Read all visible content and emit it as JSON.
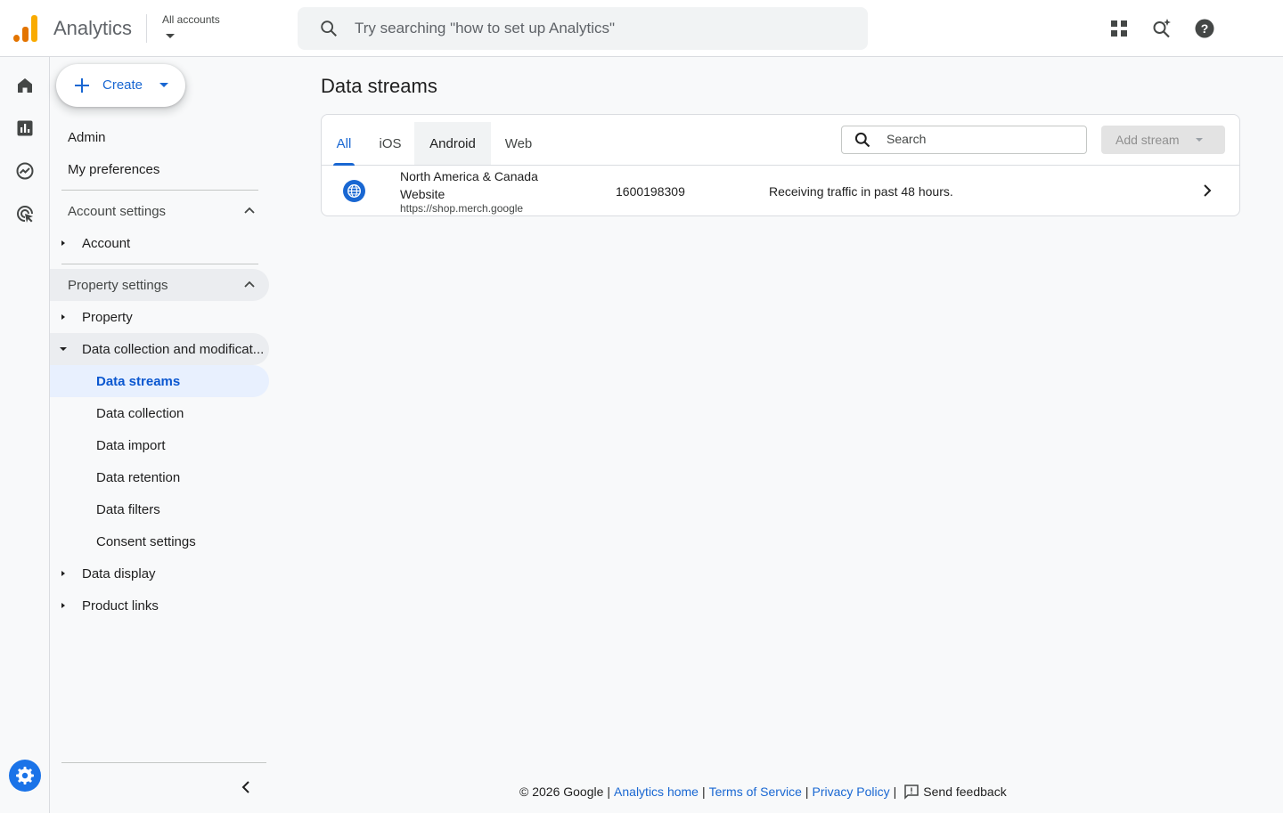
{
  "header": {
    "app_title": "Analytics",
    "account_label": "All accounts",
    "search_placeholder": "Try searching \"how to set up Analytics\""
  },
  "rail": {
    "items": [
      "home-icon",
      "reports-icon",
      "explore-icon",
      "advertising-icon"
    ],
    "admin": "admin-gear-icon"
  },
  "sidenav": {
    "create_label": "Create",
    "admin": "Admin",
    "my_preferences": "My preferences",
    "account_settings": "Account settings",
    "account": "Account",
    "property_settings": "Property settings",
    "property": "Property",
    "data_collection_group": "Data collection and modificat...",
    "data_streams": "Data streams",
    "data_collection": "Data collection",
    "data_import": "Data import",
    "data_retention": "Data retention",
    "data_filters": "Data filters",
    "consent_settings": "Consent settings",
    "data_display": "Data display",
    "product_links": "Product links"
  },
  "main": {
    "title": "Data streams",
    "tabs": [
      {
        "label": "All",
        "selected": true
      },
      {
        "label": "iOS",
        "selected": false
      },
      {
        "label": "Android",
        "selected": false
      },
      {
        "label": "Web",
        "selected": false
      }
    ],
    "search_placeholder": "Search",
    "add_stream_label": "Add stream",
    "streams": [
      {
        "name": "North America & Canada Website",
        "url": "https://shop.merch.google",
        "id": "1600198309",
        "status": "Receiving traffic in past 48 hours."
      }
    ]
  },
  "footer": {
    "copyright": "© 2026 Google",
    "analytics_home": "Analytics home",
    "terms": "Terms of Service",
    "privacy": "Privacy Policy",
    "feedback": "Send feedback"
  },
  "colors": {
    "accent": "#1967d2",
    "active_bg": "#e8f0fe",
    "logo_orange": "#e37400",
    "logo_yellow": "#f9ab00"
  }
}
